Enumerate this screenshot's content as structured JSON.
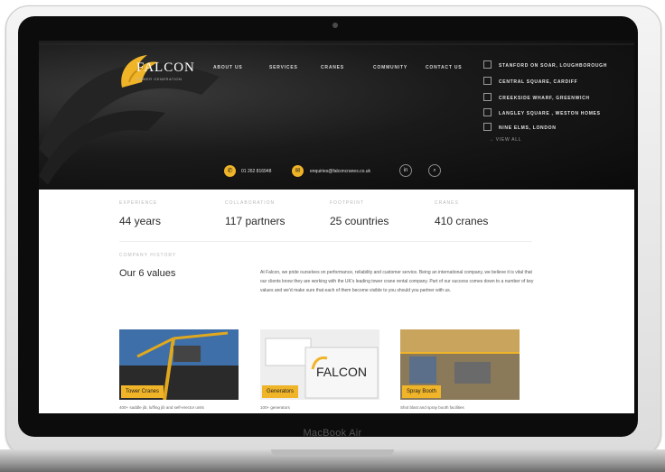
{
  "device": {
    "label": "MacBook Air"
  },
  "site": {
    "logo_text": "FALCON",
    "logo_subtext": "POWER GENERATION",
    "nav": [
      "ABOUT US",
      "SERVICES",
      "CRANES",
      "COMMUNITY",
      "CONTACT US"
    ],
    "projects": [
      "STANFORD ON SOAR, LOUGHBOROUGH",
      "CENTRAL SQUARE, CARDIFF",
      "CREEKSIDE WHARF, GREENWICH",
      "LANGLEY SQUARE , WESTON HOMES",
      "NINE ELMS, LONDON"
    ],
    "view_all": "→ VIEW ALL",
    "contact": {
      "phone": "01 262 816948",
      "email": "enquiries@falconcranes.co.uk"
    },
    "social": {
      "linkedin": "in",
      "search": "⌕"
    }
  },
  "stats": [
    {
      "label": "EXPERIENCE",
      "value": "44 years"
    },
    {
      "label": "COLLABORATION",
      "value": "117 partners"
    },
    {
      "label": "FOOTPRINT",
      "value": "25 countries"
    },
    {
      "label": "CRANES",
      "value": "410 cranes"
    }
  ],
  "history": {
    "label": "COMPANY HISTORY",
    "title": "Our 6 values",
    "body": "At Falcon, we pride ourselves on performance, reliability and customer service. Being an international company, we believe it is vital that our clients know they are working with the UK's leading tower crane rental company. Part of our success comes down to a number of key values and we'd make sure that each of them become visible to you should you partner with us."
  },
  "cards": [
    {
      "label": "Tower Cranes",
      "caption": "400+ saddle jib, luffing jib and self-erector units"
    },
    {
      "label": "Generators",
      "caption": "100+ generators"
    },
    {
      "label": "Spray Booth",
      "caption": "Shot blast and spray booth facilities"
    }
  ],
  "colors": {
    "accent": "#f0b429",
    "dark": "#0f0f0f"
  }
}
